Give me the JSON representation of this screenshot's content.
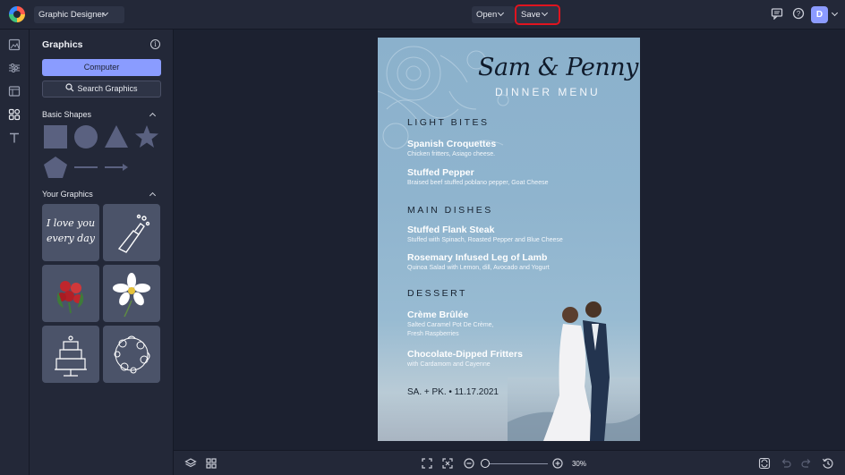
{
  "app": {
    "mode_label": "Graphic Designer"
  },
  "toolbar": {
    "open_label": "Open",
    "save_label": "Save",
    "avatar_initial": "D"
  },
  "panel": {
    "title": "Graphics",
    "computer_label": "Computer",
    "search_label": "Search Graphics",
    "basic_shapes_label": "Basic Shapes",
    "your_graphics_label": "Your Graphics",
    "shapes": [
      "square",
      "circle",
      "triangle",
      "star",
      "pentagon",
      "line",
      "arrow"
    ],
    "graphics": [
      "love-you-every-day-lettering",
      "champagne-bottle",
      "red-rose-bouquet",
      "white-flower",
      "wedding-cake",
      "floral-wreath"
    ]
  },
  "menu": {
    "names": "Sam & Penny",
    "subtitle": "DINNER MENU",
    "sections": [
      {
        "heading": "LIGHT BITES",
        "items": [
          {
            "name": "Spanish Croquettes",
            "desc": "Chicken fritters, Asiago cheese."
          },
          {
            "name": "Stuffed Pepper",
            "desc": "Braised beef stuffed poblano pepper, Goat Cheese"
          }
        ]
      },
      {
        "heading": "MAIN DISHES",
        "items": [
          {
            "name": "Stuffed Flank Steak",
            "desc": "Stuffed with Spinach, Roasted Pepper and Blue Cheese"
          },
          {
            "name": "Rosemary Infused Leg of Lamb",
            "desc": "Quinoa Salad with Lemon, dill, Avocado and Yogurt"
          }
        ]
      },
      {
        "heading": "DESSERT",
        "items": [
          {
            "name": "Crème Brûlée",
            "desc1": "Salted Caramel Pot De Crème,",
            "desc2": "Fresh Raspberries"
          },
          {
            "name": "Chocolate-Dipped Fritters",
            "desc": "with Cardamom and Cayenne"
          }
        ]
      }
    ],
    "footer": "SA. + PK. • 11.17.2021"
  },
  "zoom": {
    "value": "30%",
    "level": 0.03
  },
  "colors": {
    "accent": "#8a9cff",
    "save_highlight": "#e0141f",
    "background": "#1c2130"
  }
}
